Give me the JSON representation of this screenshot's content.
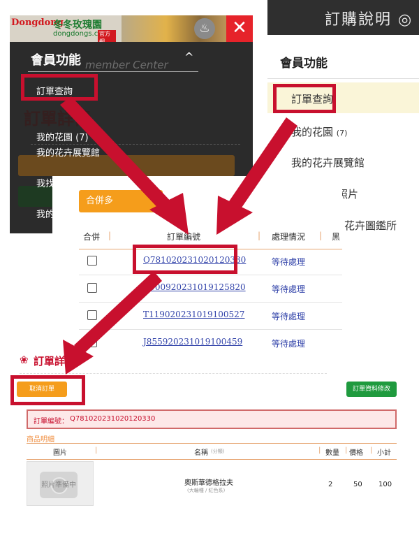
{
  "colors": {
    "highlight_red": "#c8102e",
    "orange_button": "#f59d1b",
    "green_button": "#1f9a3e",
    "link_blue": "#3344aa"
  },
  "mobile_menu": {
    "logo": {
      "brand": "Dongdong",
      "name": "冬冬玫瑰園",
      "url": "dongdongs.com",
      "tag": "官方網"
    },
    "bell_icon": "bell-icon",
    "close_icon": "close-icon",
    "title": "會員功能",
    "subtitle": "member Center",
    "caret": "^",
    "items": [
      {
        "label": "訂單查詢"
      },
      {
        "label": "我的花園 (7)"
      },
      {
        "label": "我的花卉展覽館"
      },
      {
        "label": "我找"
      },
      {
        "label": "我的"
      }
    ],
    "bg_title": "訂單詳情"
  },
  "desktop_sidebar": {
    "top_title": "訂購說明 ◎",
    "title": "會員功能",
    "items": [
      {
        "label": "訂單查詢"
      },
      {
        "label": "我的花園",
        "count": "(7)"
      },
      {
        "label": "我的花卉展覽館"
      },
      {
        "label": "照片"
      },
      {
        "label": "花卉圖鑑所"
      }
    ]
  },
  "order_list": {
    "merge_button": "合併多",
    "columns": [
      "合併",
      "訂單編號",
      "處理情況",
      "黑"
    ],
    "rows": [
      {
        "order_no": "Q781020231020120330",
        "status": "等待處理"
      },
      {
        "order_no": "C900920231019125820",
        "status": "等待處理"
      },
      {
        "order_no": "T119020231019100527",
        "status": "等待處理"
      },
      {
        "order_no": "J855920231019100459",
        "status": "等待處理"
      }
    ]
  },
  "order_detail": {
    "title": "訂單詳情",
    "cancel_button": "取消訂單",
    "modify_button": "訂單資料修改",
    "order_label": "訂單編號：",
    "order_no": "Q781020231020120330",
    "section_label": "商品明細",
    "columns": [
      "圖片",
      "名稱",
      "(分類)",
      "數量",
      "價格",
      "小計"
    ],
    "product": {
      "photo_label": "照片準備中",
      "name": "奧斯華德格拉夫",
      "sub": "(大輪種 / 紅色系)",
      "qty": "2",
      "price": "50",
      "subtotal": "100"
    }
  }
}
